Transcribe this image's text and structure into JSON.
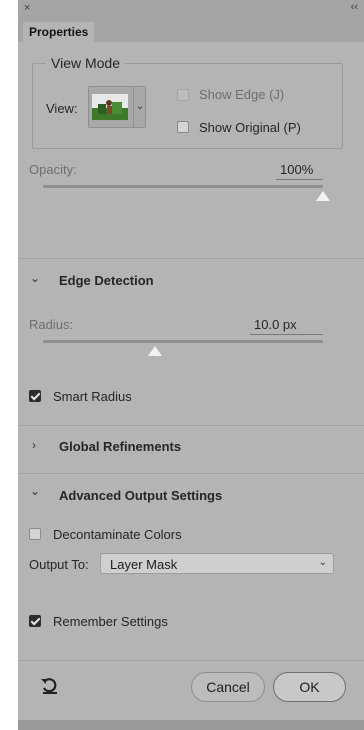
{
  "panel": {
    "close_icon": "×",
    "collapse_icon": "‹‹",
    "tab_label": "Properties"
  },
  "view_mode": {
    "legend": "View Mode",
    "view_label": "View:",
    "show_edge_label": "Show Edge (J)",
    "show_edge_checked": false,
    "show_edge_disabled": true,
    "show_original_label": "Show Original (P)",
    "show_original_checked": false
  },
  "opacity": {
    "label": "Opacity:",
    "value_text": "100%",
    "value": 100
  },
  "edge_detection": {
    "title": "Edge Detection",
    "expanded": true,
    "radius_label": "Radius:",
    "radius_text": "10.0 px",
    "radius_fraction": 0.4,
    "smart_radius_label": "Smart Radius",
    "smart_radius_checked": true
  },
  "global_refinements": {
    "title": "Global Refinements",
    "expanded": false
  },
  "advanced_output": {
    "title": "Advanced Output Settings",
    "expanded": true,
    "decontaminate_label": "Decontaminate Colors",
    "decontaminate_checked": false,
    "output_to_label": "Output To:",
    "output_to_value": "Layer Mask",
    "remember_label": "Remember Settings",
    "remember_checked": true
  },
  "footer": {
    "reset_icon": "reset-icon",
    "cancel_label": "Cancel",
    "ok_label": "OK"
  },
  "colors": {
    "panel_bg": "#b4b4b4",
    "slider_thumb": "#f2f2f2"
  }
}
